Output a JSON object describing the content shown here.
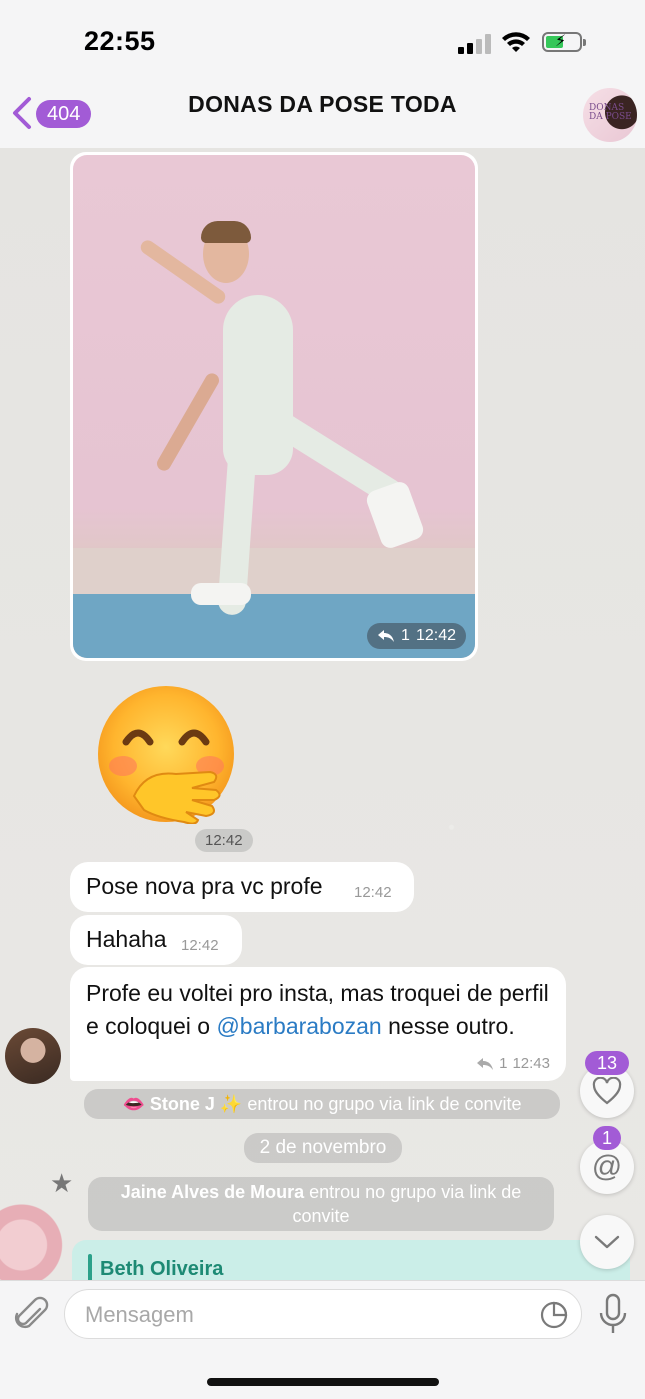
{
  "status_bar": {
    "time": "22:55"
  },
  "header": {
    "back_count": "404",
    "title": "DONAS DA POSE TODA",
    "avatar_text": "DONAS DA POSE"
  },
  "messages": {
    "photo": {
      "reply_count": "1",
      "time": "12:42"
    },
    "sticker": {
      "time": "12:42"
    },
    "m1": {
      "text": "Pose nova pra vc profe",
      "time": "12:42"
    },
    "m2": {
      "text": "Hahaha",
      "time": "12:42"
    },
    "m3": {
      "text_before": "Profe eu voltei pro insta, mas troquei de perfil e coloquei o ",
      "mention": "@barbarabozan",
      "text_after": " nesse outro.",
      "reply_count": "1",
      "time": "12:43"
    }
  },
  "service": {
    "join1_prefix": "👄 ",
    "join1_name": "Stone J ✨",
    "join1_action": " entrou no grupo via link de convite",
    "date": "2 de novembro",
    "join2_name": "Jaine Alves de Moura",
    "join2_action": " entrou no grupo via link de convite"
  },
  "quote": {
    "name": "Beth Oliveira"
  },
  "floating": {
    "reactions_badge": "13",
    "mentions_badge": "1"
  },
  "input": {
    "placeholder": "Mensagem"
  },
  "colors": {
    "accent": "#a25bd6",
    "mention": "#2a7bc4",
    "quote": "#1d8a74"
  }
}
